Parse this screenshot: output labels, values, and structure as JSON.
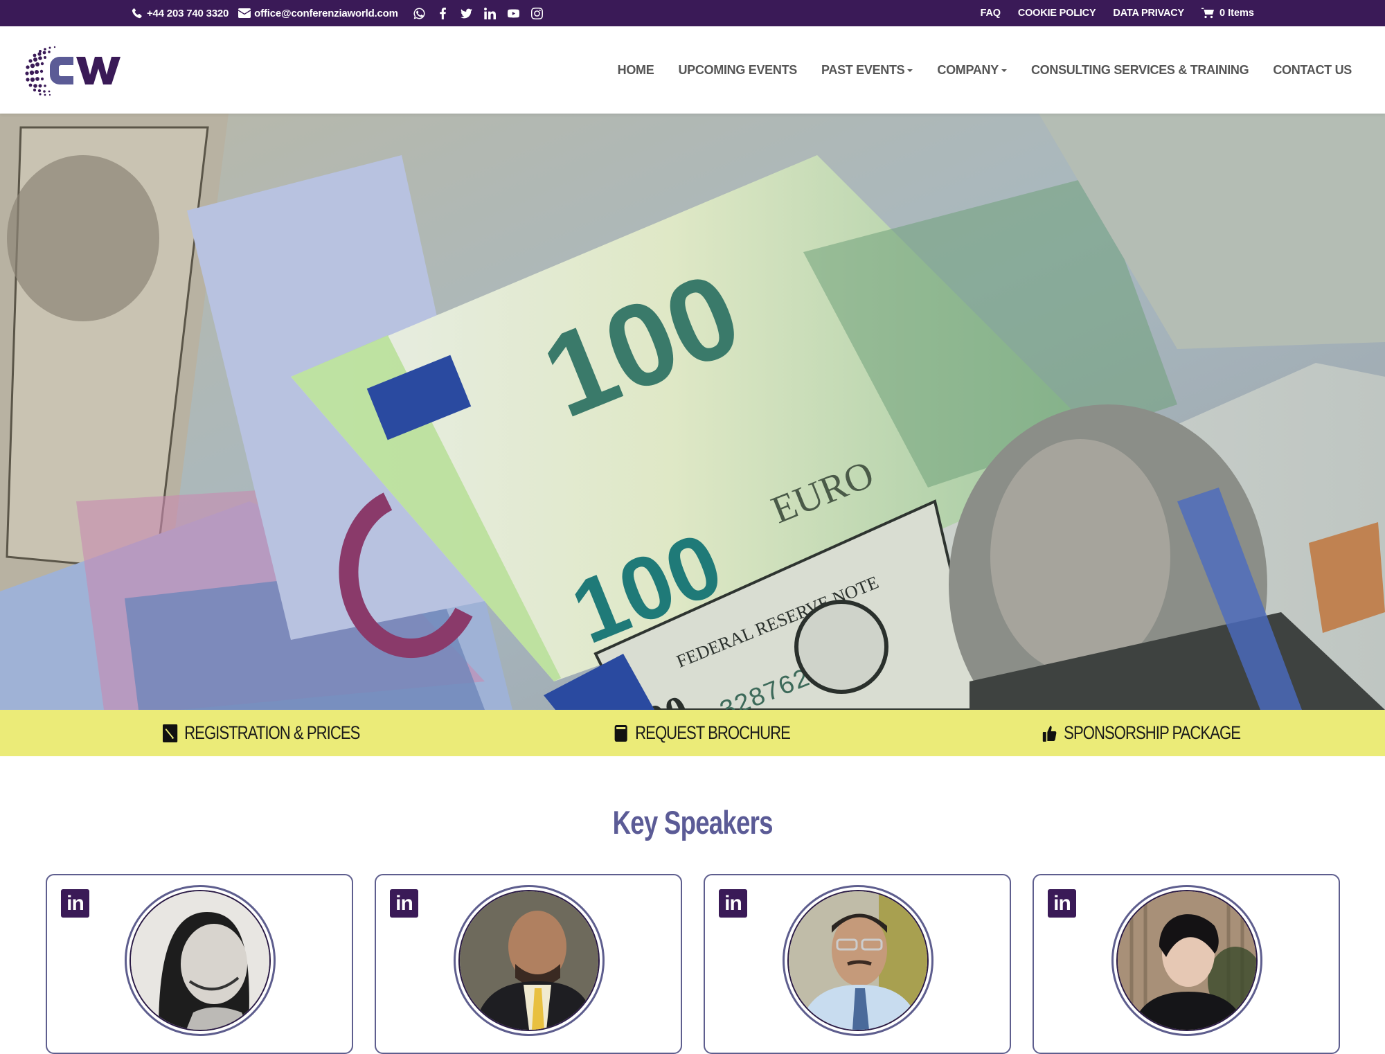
{
  "topbar": {
    "phone": "+44 203 740 3320",
    "email": "office@conferenziaworld.com",
    "social": [
      "whatsapp-icon",
      "facebook-icon",
      "twitter-icon",
      "linkedin-icon",
      "youtube-icon",
      "instagram-icon"
    ],
    "links": [
      "FAQ",
      "COOKIE POLICY",
      "DATA PRIVACY"
    ],
    "cart_label": "0 Items"
  },
  "header": {
    "logo_text": "CW",
    "nav": [
      {
        "label": "HOME",
        "dropdown": false
      },
      {
        "label": "UPCOMING EVENTS",
        "dropdown": false
      },
      {
        "label": "PAST EVENTS",
        "dropdown": true
      },
      {
        "label": "COMPANY",
        "dropdown": true
      },
      {
        "label": "CONSULTING SERVICES & TRAINING",
        "dropdown": false
      },
      {
        "label": "CONTACT US",
        "dropdown": false
      }
    ]
  },
  "hero": {
    "image_description": "Euro and US dollar banknotes (100 EUR and 100 USD)"
  },
  "actions": [
    {
      "label": "REGISTRATION & PRICES",
      "icon": "edit-icon"
    },
    {
      "label": "REQUEST BROCHURE",
      "icon": "book-icon"
    },
    {
      "label": "SPONSORSHIP PACKAGE",
      "icon": "thumbs-up-icon"
    }
  ],
  "speakers": {
    "title": "Key Speakers",
    "cards": [
      {
        "linkedin_label": "in",
        "photo": "woman with long dark hair, black and white"
      },
      {
        "linkedin_label": "in",
        "photo": "bald man in suit with yellow tie"
      },
      {
        "linkedin_label": "in",
        "photo": "man with glasses, light blue shirt and tie"
      },
      {
        "linkedin_label": "in",
        "photo": "woman with short dark hair, black blouse"
      }
    ]
  },
  "colors": {
    "brand_purple": "#3a1a57",
    "accent_yellow": "#ebeb78",
    "heading_purple": "#5b5b96",
    "card_border": "#5e5e8e"
  }
}
